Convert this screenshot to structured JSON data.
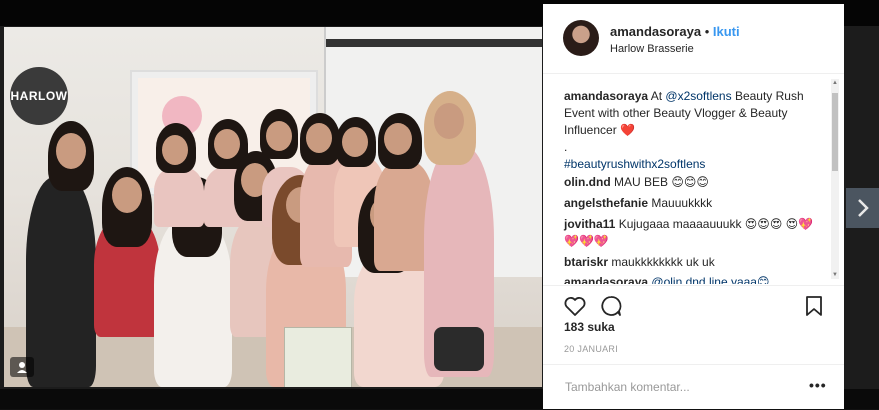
{
  "photo": {
    "logo_text": "HARLOW",
    "multi_icon": "multiple-photos-icon"
  },
  "header": {
    "username": "amandasoraya",
    "separator": "•",
    "follow_label": "Ikuti",
    "location": "Harlow Brasserie"
  },
  "caption": {
    "username": "amandasoraya",
    "text_before": "At ",
    "mention": "@x2softlens",
    "text_after": " Beauty Rush Event with other Beauty Vlogger & Beauty Influencer ❤️",
    "dot": ".",
    "hashtag": "#beautyrushwithx2softlens"
  },
  "comments": [
    {
      "username": "olin.dnd",
      "text": "MAU BEB 😊😊😊"
    },
    {
      "username": "angelsthefanie",
      "text": "Mauuukkkk"
    },
    {
      "username": "jovitha11",
      "text": "Kujugaaa maaaauuukk 😍😍😍 😍💖💖💖💖"
    },
    {
      "username": "btariskr",
      "text": "maukkkkkkkk uk uk"
    },
    {
      "username": "amandasoraya",
      "text": "@olin.dnd line yaaa😊"
    }
  ],
  "actions": {
    "like_icon": "heart-icon",
    "comment_icon": "comment-icon",
    "save_icon": "bookmark-icon"
  },
  "likes_text": "183 suka",
  "date_text": "20 JANUARI",
  "add_comment": {
    "placeholder": "Tambahkan komentar...",
    "more_label": "•••"
  },
  "nav": {
    "next_icon": "chevron-right-icon"
  },
  "colors": {
    "link": "#003569",
    "follow": "#3897f0"
  }
}
